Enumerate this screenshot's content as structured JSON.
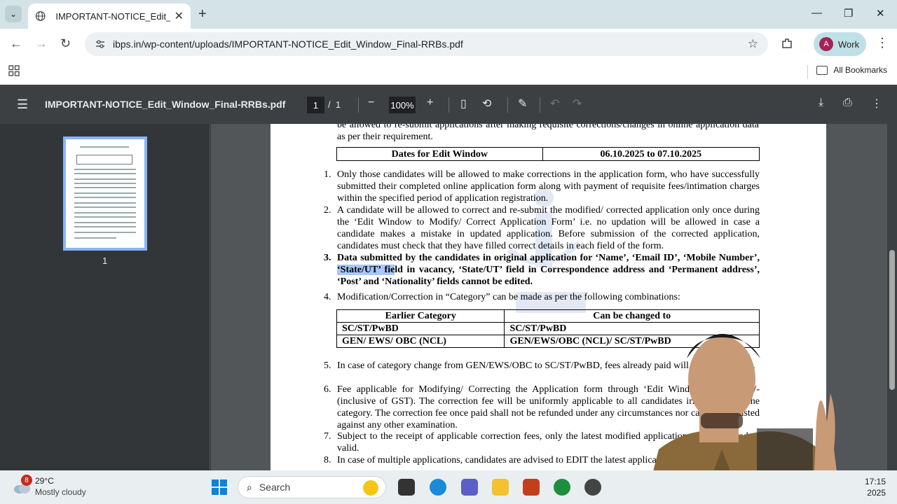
{
  "browser": {
    "tab_title": "IMPORTANT-NOTICE_Edit_Window_Final-RRBs.pdf",
    "url": "ibps.in/wp-content/uploads/IMPORTANT-NOTICE_Edit_Window_Final-RRBs.pdf",
    "profile_initial": "A",
    "profile_label": "Work",
    "all_bookmarks": "All Bookmarks"
  },
  "pdf_toolbar": {
    "title": "IMPORTANT-NOTICE_Edit_Window_Final-RRBs.pdf",
    "current_page": "1",
    "separator": "/",
    "total_pages": "1",
    "zoom": "100%"
  },
  "sidebar": {
    "thumbnail_label": "1"
  },
  "document": {
    "intro": "be allowed to re-submit applications after making requisite corrections/changes in online application data as per their requirement.",
    "dates_label": "Dates for Edit Window",
    "dates_value": "06.10.2025 to 07.10.2025",
    "items": [
      {
        "n": "1.",
        "text": "Only those candidates will be allowed to make corrections in the application form, who have successfully submitted their completed online application form along with payment of requisite fees/intimation charges within the specified period of application registration."
      },
      {
        "n": "2.",
        "text": "A candidate will be allowed to correct and re-submit the modified/ corrected application only once during the ‘Edit Window to Modify/ Correct Application Form’ i.e. no updation will be allowed in case a candidate makes a mistake in updated application. Before submission of the corrected application, candidates must check that they have filled correct details in each field of the form."
      },
      {
        "n": "3.",
        "text_before": "Data submitted by the candidates in original application for ‘Name’, ‘Email ID’, ‘Mobile Number’, ",
        "text_highlight": "‘State/UT’ fie",
        "text_after": "ld in vacancy, ‘State/UT’ field in Correspondence address and ‘Permanent address’, ‘Post’ and ‘Nationality’ fields cannot be edited."
      },
      {
        "n": "4.",
        "text": "Modification/Correction in “Category” can be made as per the following combinations:"
      },
      {
        "n": "5.",
        "text": "In case of category change from GEN/EWS/OBC to SC/ST/PwBD, fees already paid will not be refunded."
      },
      {
        "n": "6.",
        "text": "Fee applicable for Modifying/ Correcting the Application form through ‘Edit Window’ is Rs. 200/- (inclusive of GST). The correction fee will be uniformly applicable to all candidates irrespective of the category. The correction fee once paid shall not be refunded under any circumstances nor can it be adjusted against any other examination."
      },
      {
        "n": "7.",
        "text": "Subject to the receipt of applicable correction fees, only the latest modified application will be treated as valid."
      },
      {
        "n": "8.",
        "text": "In case of multiple applications, candidates are advised to EDIT the latest application only."
      }
    ],
    "category_table": {
      "headers": [
        "Earlier Category",
        "Can be changed to"
      ],
      "rows": [
        [
          "SC/ST/PwBD",
          "SC/ST/PwBD"
        ],
        [
          "GEN/ EWS/ OBC (NCL)",
          "GEN/EWS/OBC (NCL)/ SC/ST/PwBD"
        ]
      ]
    }
  },
  "taskbar": {
    "weather_badge": "8",
    "temperature": "29°C",
    "condition": "Mostly cloudy",
    "search_label": "Search",
    "time": "17:15",
    "date": "2025"
  }
}
